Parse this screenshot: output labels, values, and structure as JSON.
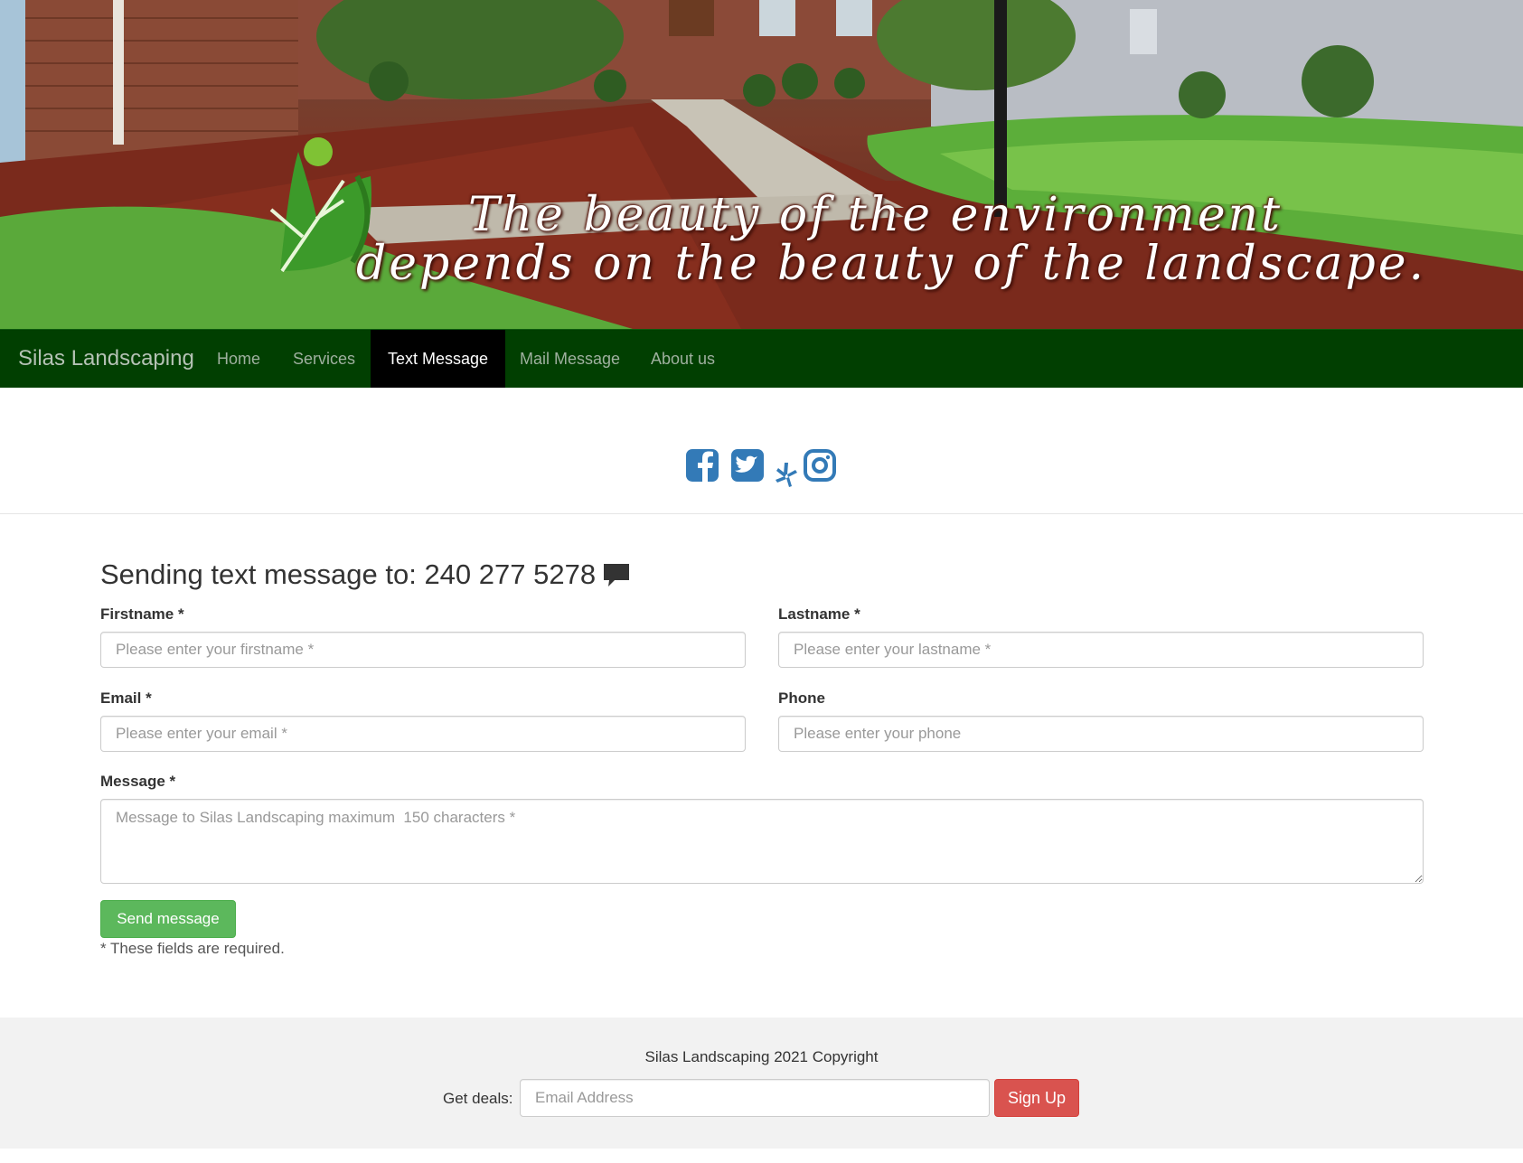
{
  "hero": {
    "tagline_line1": "The beauty of the environment",
    "tagline_line2": "depends on the beauty of the landscape."
  },
  "navbar": {
    "brand": "Silas Landscaping",
    "items": [
      {
        "label": "Home",
        "active": false
      },
      {
        "label": "Services",
        "active": false
      },
      {
        "label": "Text Message",
        "active": true
      },
      {
        "label": "Mail Message",
        "active": false
      },
      {
        "label": "About us",
        "active": false
      }
    ],
    "background": "#013f01"
  },
  "social": {
    "icons": [
      "facebook-icon",
      "twitter-icon",
      "yelp-icon",
      "instagram-icon"
    ],
    "color": "#337ab7"
  },
  "form": {
    "title": "Sending text message to: 240 277 5278",
    "firstname": {
      "label": "Firstname *",
      "placeholder": "Please enter your firstname *",
      "value": ""
    },
    "lastname": {
      "label": "Lastname *",
      "placeholder": "Please enter your lastname *",
      "value": ""
    },
    "email": {
      "label": "Email *",
      "placeholder": "Please enter your email *",
      "value": ""
    },
    "phone": {
      "label": "Phone",
      "placeholder": "Please enter your phone",
      "value": ""
    },
    "message": {
      "label": "Message *",
      "placeholder": "Message to Silas Landscaping maximum  150 characters *",
      "value": ""
    },
    "send_label": "Send message",
    "required_note": "* These fields are required."
  },
  "footer": {
    "copyright": "Silas Landscaping 2021 Copyright",
    "deals_label": "Get deals:",
    "email_placeholder": "Email Address",
    "signup_label": "Sign Up"
  }
}
